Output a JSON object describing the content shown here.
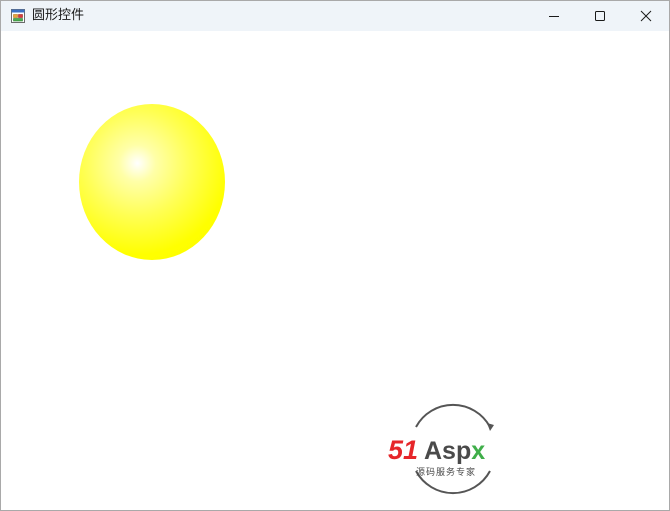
{
  "window": {
    "title": "圆形控件"
  },
  "caption_buttons": {
    "minimize_icon": "minimize-icon",
    "maximize_icon": "maximize-icon",
    "close_icon": "close-icon"
  },
  "circle_control": {
    "fill_color": "#ffff00",
    "highlight_color": "#ffffff"
  },
  "watermark": {
    "brand_51": "51",
    "brand_aspx": "Aspx",
    "tagline": "源码服务专家",
    "colors": {
      "red": "#e6262a",
      "dark": "#4a4a4a",
      "green": "#3fae49"
    }
  }
}
